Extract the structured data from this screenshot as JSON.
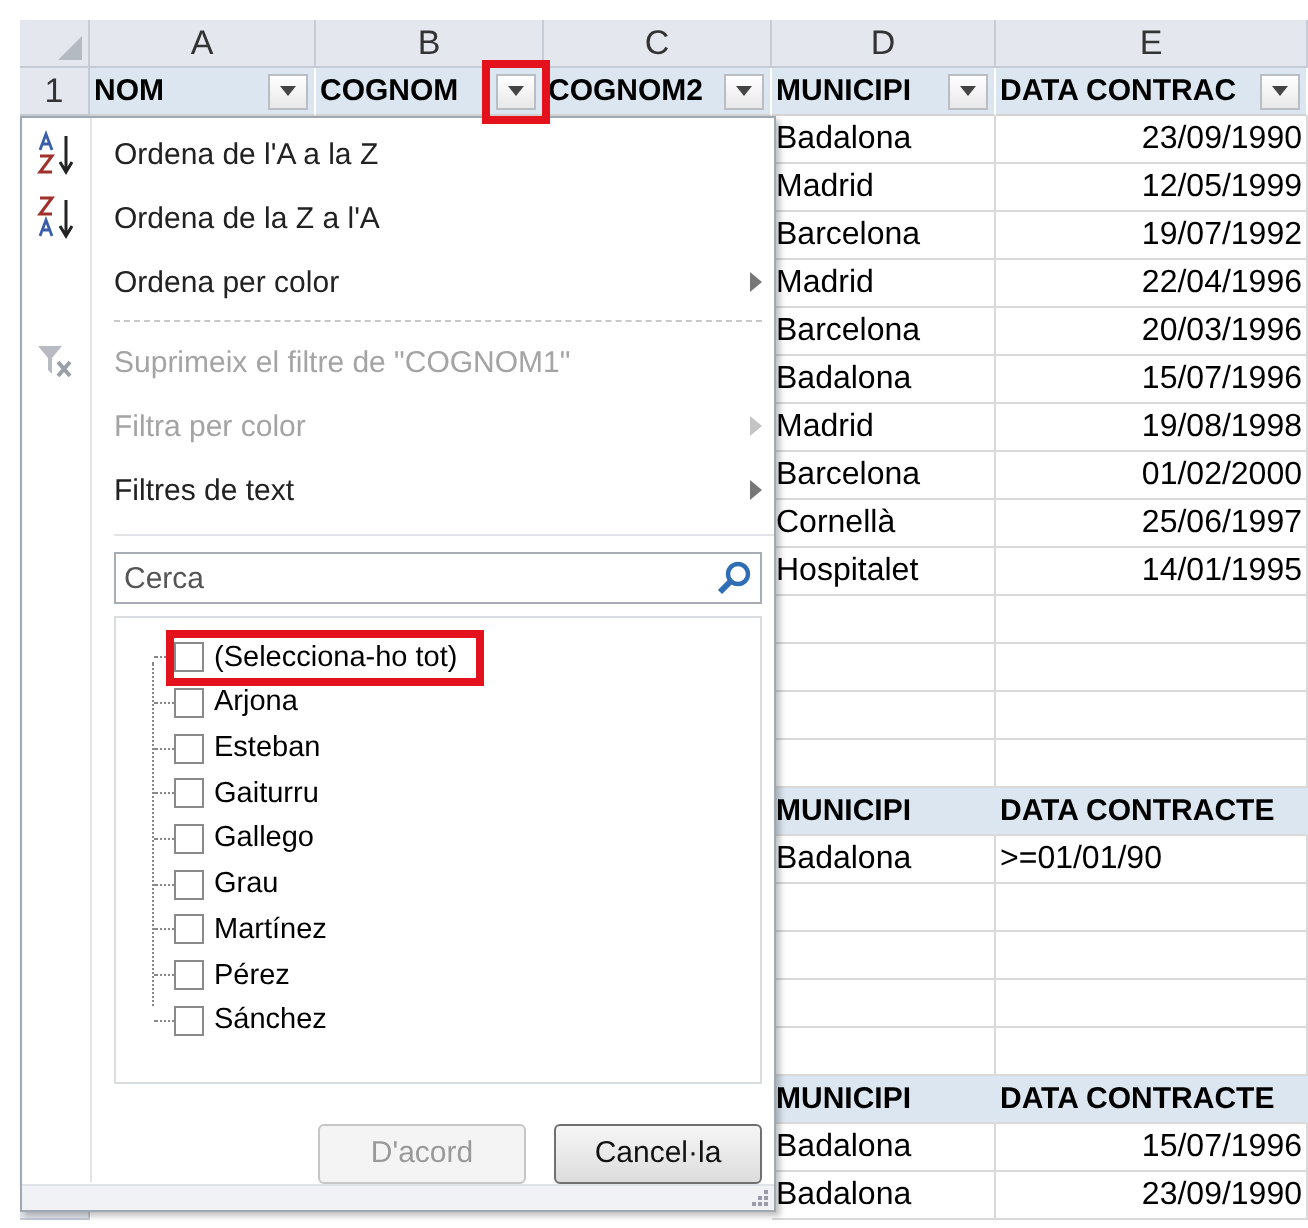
{
  "column_letters": [
    "A",
    "B",
    "C",
    "D",
    "E"
  ],
  "header_row": {
    "number": "1",
    "cells": [
      {
        "label": "NOM",
        "highlighted": false
      },
      {
        "label": "COGNOM",
        "highlighted": true
      },
      {
        "label": "COGNOM2",
        "highlighted": false
      },
      {
        "label": "MUNICIPI",
        "highlighted": false
      },
      {
        "label": "DATA CONTRAC",
        "highlighted": false
      }
    ]
  },
  "rows": [
    {
      "kind": "data",
      "municipi": "Badalona",
      "date": "23/09/1990"
    },
    {
      "kind": "data",
      "municipi": "Madrid",
      "date": "12/05/1999"
    },
    {
      "kind": "data",
      "municipi": "Barcelona",
      "date": "19/07/1992"
    },
    {
      "kind": "data",
      "municipi": "Madrid",
      "date": "22/04/1996"
    },
    {
      "kind": "data",
      "municipi": "Barcelona",
      "date": "20/03/1996"
    },
    {
      "kind": "data",
      "municipi": "Badalona",
      "date": "15/07/1996"
    },
    {
      "kind": "data",
      "municipi": "Madrid",
      "date": "19/08/1998"
    },
    {
      "kind": "data",
      "municipi": "Barcelona",
      "date": "01/02/2000"
    },
    {
      "kind": "data",
      "municipi": "Cornellà",
      "date": "25/06/1997"
    },
    {
      "kind": "data",
      "municipi": "Hospitalet",
      "date": "14/01/1995"
    },
    {
      "kind": "empty"
    },
    {
      "kind": "empty"
    },
    {
      "kind": "empty"
    },
    {
      "kind": "empty"
    },
    {
      "kind": "header",
      "municipi": "MUNICIPI",
      "date": "DATA CONTRACTE"
    },
    {
      "kind": "criteria",
      "municipi": "Badalona",
      "date": ">=01/01/90"
    },
    {
      "kind": "empty"
    },
    {
      "kind": "empty"
    },
    {
      "kind": "empty"
    },
    {
      "kind": "empty"
    },
    {
      "kind": "header",
      "municipi": "MUNICIPI",
      "date": "DATA CONTRACTE"
    },
    {
      "kind": "data",
      "municipi": "Badalona",
      "date": "15/07/1996"
    },
    {
      "kind": "data",
      "municipi": "Badalona",
      "date": "23/09/1990"
    }
  ],
  "filter_menu": {
    "items": [
      {
        "kind": "sort-az",
        "label": "Ordena de l'A a la Z",
        "disabled": false,
        "submenu": false
      },
      {
        "kind": "sort-za",
        "label": "Ordena de la Z a l'A",
        "disabled": false,
        "submenu": false
      },
      {
        "kind": "plain",
        "label": "Ordena per color",
        "disabled": false,
        "submenu": true
      },
      {
        "kind": "separator"
      },
      {
        "kind": "clear-filter",
        "label": "Suprimeix el filtre de \"COGNOM1\"",
        "disabled": true,
        "submenu": false
      },
      {
        "kind": "plain",
        "label": "Filtra per color",
        "disabled": true,
        "submenu": true
      },
      {
        "kind": "plain",
        "label": "Filtres de text",
        "disabled": false,
        "submenu": true
      }
    ],
    "search": {
      "placeholder": "Cerca"
    },
    "values": [
      {
        "label": "(Selecciona-ho tot)",
        "checked": false,
        "highlighted": true
      },
      {
        "label": "Arjona",
        "checked": false,
        "highlighted": false
      },
      {
        "label": "Esteban",
        "checked": false,
        "highlighted": false
      },
      {
        "label": "Gaiturru",
        "checked": false,
        "highlighted": false
      },
      {
        "label": "Gallego",
        "checked": false,
        "highlighted": false
      },
      {
        "label": "Grau",
        "checked": false,
        "highlighted": false
      },
      {
        "label": "Martínez",
        "checked": false,
        "highlighted": false
      },
      {
        "label": "Pérez",
        "checked": false,
        "highlighted": false
      },
      {
        "label": "Sánchez",
        "checked": false,
        "highlighted": false
      }
    ],
    "buttons": [
      {
        "label": "D'acord",
        "disabled": true
      },
      {
        "label": "Cancel·la",
        "disabled": false
      }
    ]
  }
}
